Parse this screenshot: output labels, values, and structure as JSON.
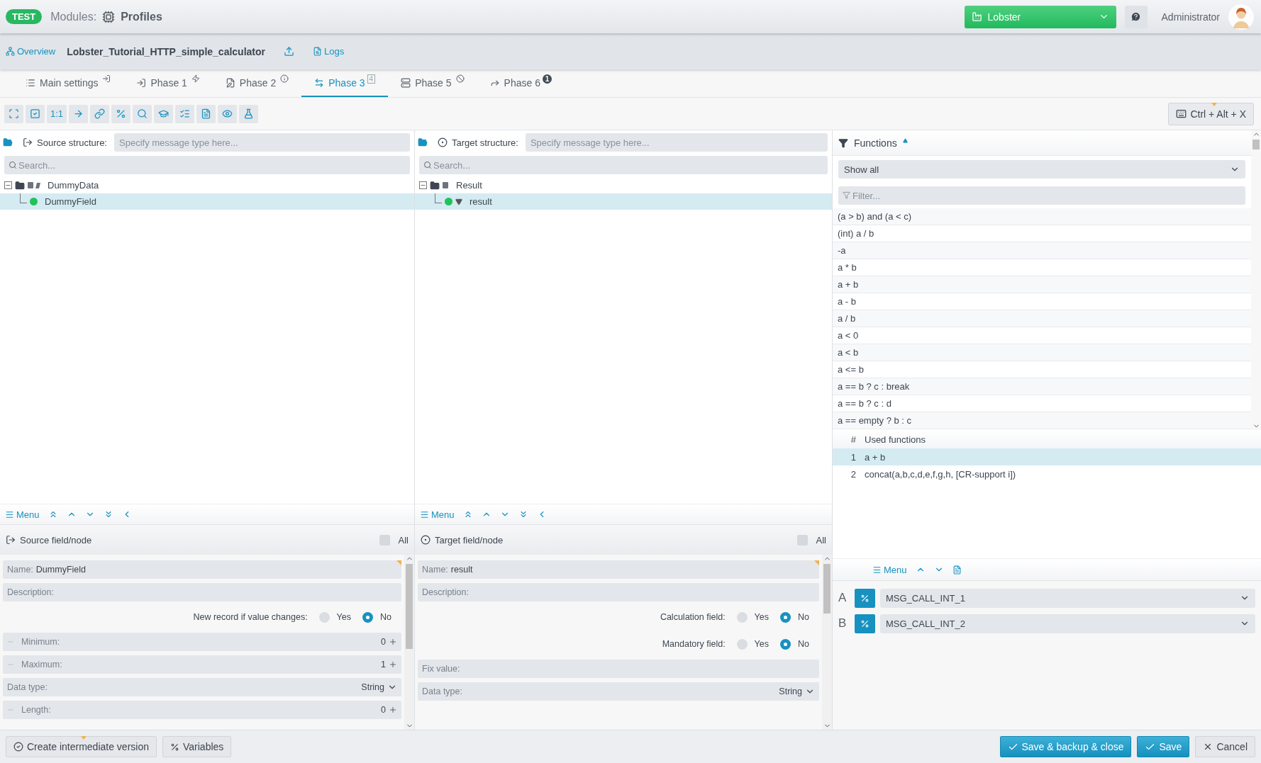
{
  "header": {
    "env_badge": "TEST",
    "modules_label": "Modules:",
    "module": "Profiles",
    "workspace": "Lobster",
    "user": "Administrator"
  },
  "breadcrumb": {
    "overview": "Overview",
    "profile": "Lobster_Tutorial_HTTP_simple_calculator",
    "logs": "Logs"
  },
  "tabs": [
    {
      "label": "Main settings",
      "selected": false
    },
    {
      "label": "Phase 1",
      "selected": false
    },
    {
      "label": "Phase 2",
      "selected": false
    },
    {
      "label": "Phase 3",
      "selected": true,
      "badge": "4"
    },
    {
      "label": "Phase 5",
      "selected": false
    },
    {
      "label": "Phase 6",
      "selected": false,
      "badge": "1"
    }
  ],
  "toolbar": {
    "ratio_button": "1:1",
    "shortcut": "Ctrl + Alt + X"
  },
  "panels": [
    {
      "title": "Source structure:",
      "type_placeholder": "Specify message type here...",
      "search_placeholder": "Search...",
      "tree": [
        {
          "label": "DummyData",
          "expanded": true,
          "selected": false,
          "children": [
            {
              "label": "DummyField",
              "selected": true
            }
          ]
        }
      ],
      "menu": "Menu",
      "node_title": "Source field/node",
      "all_label": "All",
      "all_checked": false,
      "fields": [
        {
          "kind": "text",
          "label": "Name:",
          "value": "DummyField"
        },
        {
          "kind": "text",
          "label": "Description:"
        },
        {
          "kind": "radio",
          "label": "New record if value changes:",
          "options": [
            {
              "label": "Yes",
              "selected": false
            },
            {
              "label": "No",
              "selected": true
            }
          ]
        },
        {
          "kind": "number",
          "label": "Minimum:",
          "value": "0"
        },
        {
          "kind": "number",
          "label": "Maximum:",
          "value": "1"
        },
        {
          "kind": "select",
          "label": "Data type:",
          "value": "String"
        },
        {
          "kind": "number",
          "label": "Length:",
          "value": "0"
        }
      ]
    },
    {
      "title": "Target structure:",
      "type_placeholder": "Specify message type here...",
      "search_placeholder": "Search...",
      "tree": [
        {
          "label": "Result",
          "expanded": true,
          "selected": false,
          "children": [
            {
              "label": "result",
              "selected": true
            }
          ]
        }
      ],
      "menu": "Menu",
      "node_title": "Target field/node",
      "all_label": "All",
      "all_checked": false,
      "fields": [
        {
          "kind": "text",
          "label": "Name:",
          "value": "result"
        },
        {
          "kind": "text",
          "label": "Description:"
        },
        {
          "kind": "radio",
          "label": "Calculation field:",
          "options": [
            {
              "label": "Yes",
              "selected": false
            },
            {
              "label": "No",
              "selected": true
            }
          ]
        },
        {
          "kind": "radio",
          "label": "Mandatory field:",
          "options": [
            {
              "label": "Yes",
              "selected": false
            },
            {
              "label": "No",
              "selected": true
            }
          ]
        },
        {
          "kind": "text",
          "label": "Fix value:"
        },
        {
          "kind": "select",
          "label": "Data type:",
          "value": "String"
        }
      ]
    }
  ],
  "functions": {
    "title": "Functions",
    "filter_select": "Show all",
    "filter_placeholder": "Filter...",
    "items": [
      "(a > b) and (a < c)",
      "(int) a / b",
      "-a",
      "a * b",
      "a + b",
      "a - b",
      "a / b",
      "a < 0",
      "a < b",
      "a <= b",
      "a == b ? c : break",
      "a == b ? c : d",
      "a == empty ? b : c"
    ],
    "used_header": {
      "number": "#",
      "name": "Used functions"
    },
    "used": [
      {
        "number": "1",
        "name": "a + b",
        "selected": true
      },
      {
        "number": "2",
        "name": "concat(a,b,c,d,e,f,g,h, [CR-support i])",
        "selected": false
      }
    ],
    "menu": "Menu",
    "params": [
      {
        "letter": "A",
        "value": "MSG_CALL_INT_1"
      },
      {
        "letter": "B",
        "value": "MSG_CALL_INT_2"
      }
    ]
  },
  "footer": {
    "intermediate": "Create intermediate version",
    "variables": "Variables",
    "save_close": "Save & backup & close",
    "save": "Save",
    "cancel": "Cancel"
  }
}
